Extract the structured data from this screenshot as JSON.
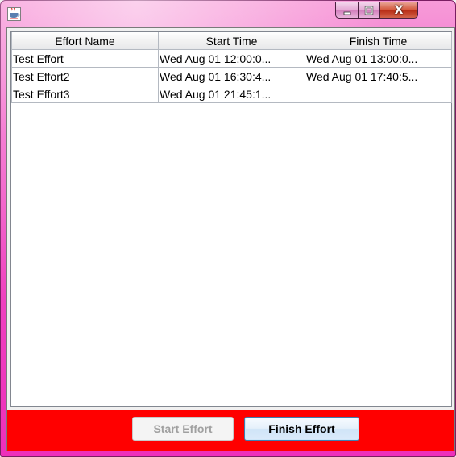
{
  "window": {
    "title": "",
    "app_icon": "java-cup-icon",
    "accent_color": "#ef44c0",
    "caption_buttons": {
      "minimize_icon": "minimize-icon",
      "maximize_icon": "maximize-icon",
      "close_icon": "close-icon",
      "close_glyph": "X"
    }
  },
  "table": {
    "columns": [
      "Effort Name",
      "Start Time",
      "Finish Time"
    ],
    "rows": [
      {
        "name": "Test Effort",
        "start": "Wed Aug 01 12:00:0...",
        "finish": "Wed Aug 01 13:00:0..."
      },
      {
        "name": "Test Effort2",
        "start": "Wed Aug 01 16:30:4...",
        "finish": "Wed Aug 01 17:40:5..."
      },
      {
        "name": "Test Effort3",
        "start": "Wed Aug 01 21:45:1...",
        "finish": ""
      }
    ]
  },
  "buttons": {
    "start_label": "Start Effort",
    "start_enabled": false,
    "finish_label": "Finish Effort",
    "finish_enabled": true,
    "bar_color": "#ff0000"
  }
}
